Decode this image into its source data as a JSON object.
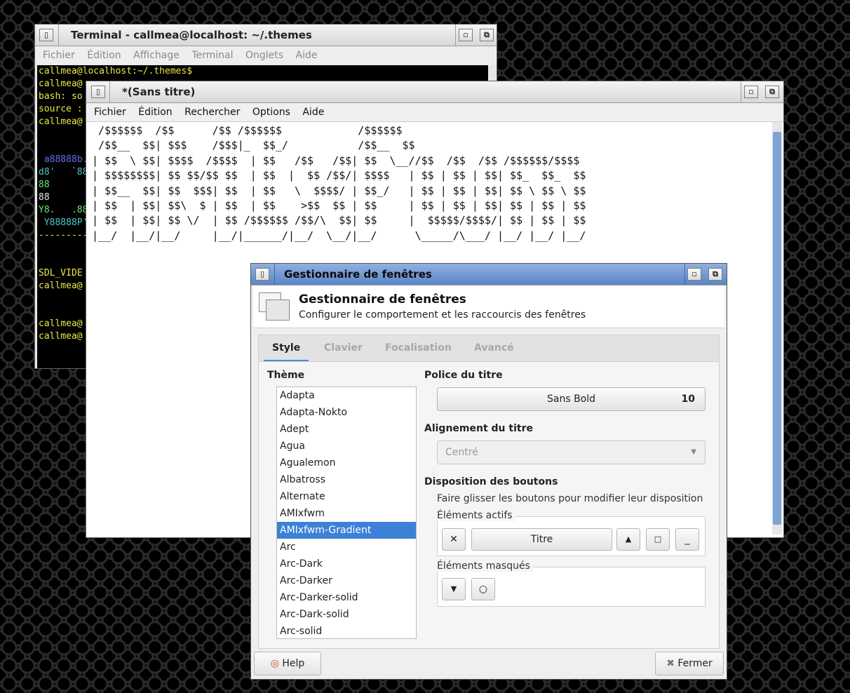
{
  "terminal": {
    "title": "Terminal - callmea@localhost: ~/.themes",
    "menu": [
      "Fichier",
      "Édition",
      "Affichage",
      "Terminal",
      "Onglets",
      "Aide"
    ],
    "lines": [
      {
        "text": "callmea@localhost:~/.themes$",
        "color": "#e8e84a"
      },
      {
        "text": "callmea@",
        "color": "#e8e84a"
      },
      {
        "text": "bash: so",
        "color": "#e8e84a"
      },
      {
        "text": "source :",
        "color": "#e8e84a"
      },
      {
        "text": "callmea@",
        "color": "#e8e84a"
      },
      {
        "text": "",
        "color": "#ffffff"
      },
      {
        "text": "",
        "color": "#ffffff"
      },
      {
        "text": " a88888b.",
        "color": "#6a6af0"
      },
      {
        "text": "d8'   `88",
        "color": "#4ac8c8"
      },
      {
        "text": "88",
        "color": "#6ae86a"
      },
      {
        "text": "88",
        "color": "#e8e8e8"
      },
      {
        "text": "Y8.   .88",
        "color": "#6ae86a"
      },
      {
        "text": " Y88888P'",
        "color": "#4ac8c8"
      },
      {
        "text": "---------",
        "color": "#e8e84a"
      },
      {
        "text": "",
        "color": "#ffffff"
      },
      {
        "text": "",
        "color": "#ffffff"
      },
      {
        "text": "SDL_VIDE",
        "color": "#e8e84a"
      },
      {
        "text": "callmea@",
        "color": "#e8e84a"
      },
      {
        "text": "",
        "color": "#ffffff"
      },
      {
        "text": "",
        "color": "#ffffff"
      },
      {
        "text": "callmea@",
        "color": "#e8e84a"
      },
      {
        "text": "callmea@",
        "color": "#e8e84a"
      }
    ]
  },
  "editor": {
    "title": "*(Sans titre)",
    "menu": [
      "Fichier",
      "Édition",
      "Rechercher",
      "Options",
      "Aide"
    ],
    "lines": [
      " /$$$$$$  /$$      /$$ /$$$$$$            /$$$$$$",
      " /$$__  $$| $$$    /$$$|_  $$_/           /$$__  $$",
      "| $$  \\ $$| $$$$  /$$$$  | $$   /$$   /$$| $$  \\__//$$  /$$  /$$ /$$$$$$/$$$$",
      "| $$$$$$$$| $$ $$/$$ $$  | $$  |  $$ /$$/| $$$$   | $$ | $$ | $$| $$_  $$_  $$",
      "| $$__  $$| $$  $$$| $$  | $$   \\  $$$$/ | $$_/   | $$ | $$ | $$| $$ \\ $$ \\ $$",
      "| $$  | $$| $$\\  $ | $$  | $$    >$$  $$ | $$     | $$ | $$ | $$| $$ | $$ | $$",
      "| $$  | $$| $$ \\/  | $$ /$$$$$$ /$$/\\  $$| $$     |  $$$$$/$$$$/| $$ | $$ | $$",
      "|__/  |__/|__/     |__/|______/|__/  \\__/|__/      \\_____/\\___/ |__/ |__/ |__/"
    ]
  },
  "wm": {
    "title": "Gestionnaire de fenêtres",
    "header_title": "Gestionnaire de fenêtres",
    "header_subtitle": "Configurer le comportement et les raccourcis des fenêtres",
    "tabs": [
      "Style",
      "Clavier",
      "Focalisation",
      "Avancé"
    ],
    "active_tab": "Style",
    "theme_label": "Thème",
    "themes": [
      "Adapta",
      "Adapta-Nokto",
      "Adept",
      "Agua",
      "Agualemon",
      "Albatross",
      "Alternate",
      "AMIxfwm",
      "AMIxfwm-Gradient",
      "Arc",
      "Arc-Dark",
      "Arc-Darker",
      "Arc-Darker-solid",
      "Arc-Dark-solid",
      "Arc-solid"
    ],
    "selected_theme": "AMIxfwm-Gradient",
    "title_font_label": "Police du titre",
    "title_font_name": "Sans Bold",
    "title_font_size": "10",
    "title_align_label": "Alignement du titre",
    "title_align_value": "Centré",
    "buttons_layout_label": "Disposition des boutons",
    "buttons_layout_hint": "Faire glisser les boutons pour modifier leur disposition",
    "active_elements_label": "Éléments actifs",
    "active_title_button": "Titre",
    "hidden_elements_label": "Éléments masqués",
    "help_label": "Help",
    "close_label": "Fermer",
    "accent": "#3d80d8"
  }
}
